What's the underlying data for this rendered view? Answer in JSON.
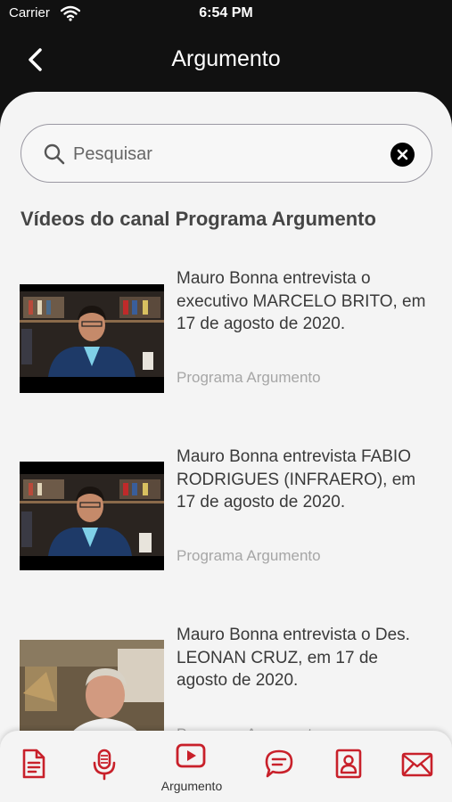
{
  "status_bar": {
    "carrier": "Carrier",
    "time": "6:54 PM"
  },
  "nav": {
    "title": "Argumento",
    "back_icon": "chevron-left-icon"
  },
  "search": {
    "placeholder": "Pesquisar",
    "value": ""
  },
  "section_title": "Vídeos do canal Programa Argumento",
  "videos": [
    {
      "title": "Mauro Bonna entrevista o executivo MARCELO BRITO, em 17 de agosto de 2020.",
      "channel": "Programa Argumento"
    },
    {
      "title": "Mauro Bonna entrevista FABIO RODRIGUES (INFRAERO), em 17 de agosto de 2020.",
      "channel": "Programa Argumento"
    },
    {
      "title": "Mauro Bonna entrevista o Des. LEONAN CRUZ, em 17 de agosto de 2020.",
      "channel": "Programa Argumento"
    }
  ],
  "tabs": [
    {
      "icon": "document-icon",
      "label": ""
    },
    {
      "icon": "microphone-icon",
      "label": ""
    },
    {
      "icon": "play-video-icon",
      "label": "Argumento",
      "active": true
    },
    {
      "icon": "chat-bubble-icon",
      "label": ""
    },
    {
      "icon": "contact-card-icon",
      "label": ""
    },
    {
      "icon": "envelope-icon",
      "label": ""
    }
  ],
  "colors": {
    "accent": "#c8202a",
    "header_bg": "#111111",
    "sheet_bg": "#f4f4f4"
  }
}
